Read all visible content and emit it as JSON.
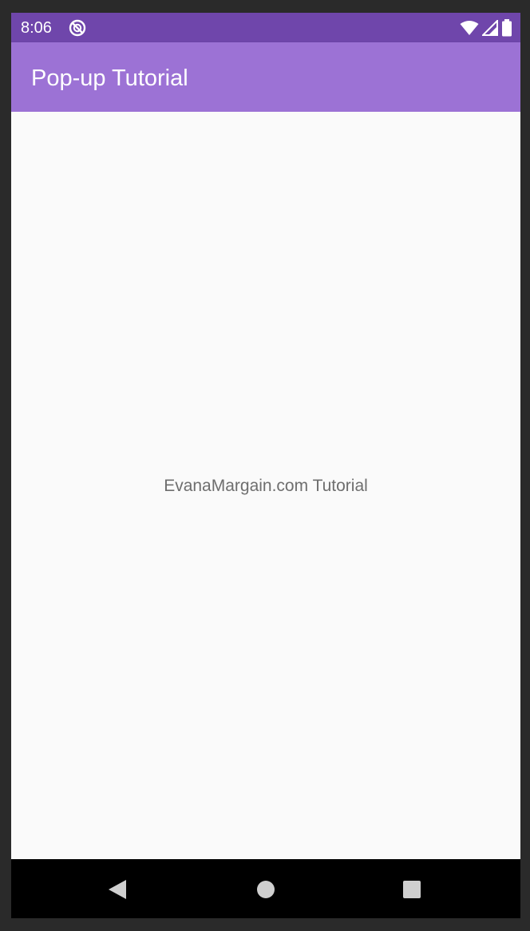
{
  "status_bar": {
    "time": "8:06",
    "notification_icon": "do-not-disturb-icon",
    "wifi_icon": "wifi-icon",
    "signal_icon": "cell-signal-icon",
    "battery_icon": "battery-icon",
    "background_color": "#6f46ab"
  },
  "app_bar": {
    "title": "Pop-up Tutorial",
    "background_color": "#9c72d5"
  },
  "main": {
    "center_text": "EvanaMargain.com Tutorial"
  },
  "nav_bar": {
    "back_icon": "back-triangle-icon",
    "home_icon": "home-circle-icon",
    "recents_icon": "recents-square-icon"
  }
}
